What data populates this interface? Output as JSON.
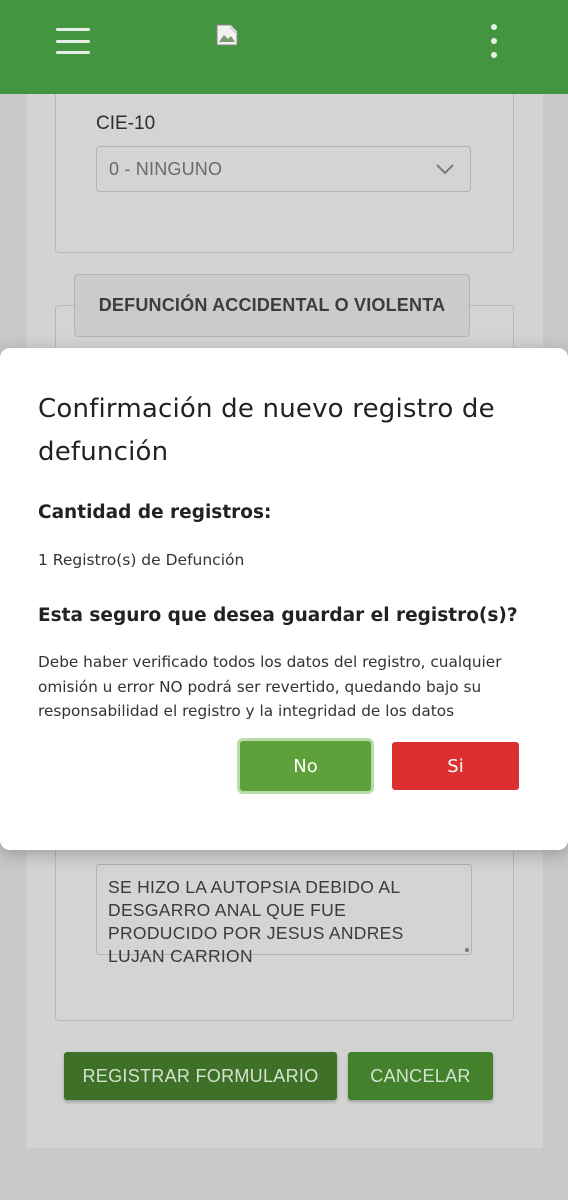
{
  "header": {
    "menu_icon": "hamburger-menu-icon",
    "logo_icon": "broken-image-icon",
    "more_icon": "kebab-more-icon",
    "color": "#43963f"
  },
  "form": {
    "cie_label": "CIE-10",
    "cie_selected": "0 - NINGUNO",
    "section_title": "DEFUNCIÓN ACCIDENTAL O VIOLENTA",
    "observations": "SE HIZO LA AUTOPSIA DEBIDO AL DESGARRO ANAL QUE FUE PRODUCIDO POR JESUS ANDRES LUJAN CARRION",
    "register_label": "REGISTRAR FORMULARIO",
    "cancel_label": "CANCELAR"
  },
  "dialog": {
    "title": "Confirmación de nuevo registro de defunción",
    "count_heading": "Cantidad de registros:",
    "count_text": "1 Registro(s) de Defunción",
    "question": "Esta seguro que desea guardar el registro(s)?",
    "warning": "Debe haber verificado todos los datos del registro, cualquier omisión u error NO podrá ser revertido, quedando bajo su responsabilidad el registro y la integridad de los datos",
    "no_label": "No",
    "si_label": "Si",
    "colors": {
      "no": "#5ea13a",
      "si": "#dc2f2f"
    }
  }
}
